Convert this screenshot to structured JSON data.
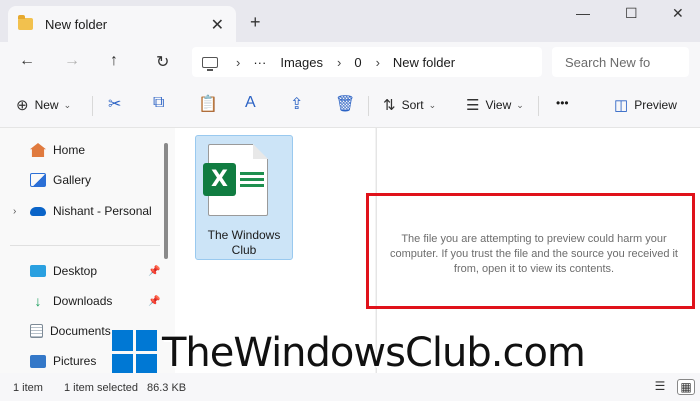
{
  "window": {
    "tab_title": "New folder",
    "tab_close": "✕",
    "new_tab": "+",
    "minimize": "—",
    "maximize": "☐",
    "close": "✕"
  },
  "nav": {
    "back": "←",
    "forward": "→",
    "up": "↑",
    "refresh": "↻"
  },
  "address": {
    "more": "···",
    "separator": "›",
    "crumbs": [
      "Images",
      "0",
      "New folder"
    ]
  },
  "search": {
    "placeholder": "Search New fo"
  },
  "toolbar": {
    "new_label": "New",
    "new_icon": "⊕",
    "chevron": "⌄",
    "cut_icon": "✂",
    "copy_icon": "⧉",
    "paste_icon": "📋",
    "rename_icon": "A",
    "share_icon": "⇪",
    "delete_icon": "🗑",
    "sort_label": "Sort",
    "sort_icon": "⇅",
    "view_label": "View",
    "view_icon": "☰",
    "more_label": "•••",
    "preview_label": "Preview",
    "preview_icon": "◫"
  },
  "sidebar": {
    "expander": "›",
    "pin": "📌",
    "items": [
      {
        "label": "Home",
        "icon": "home-icon",
        "color": "#e07a3e"
      },
      {
        "label": "Gallery",
        "icon": "gallery-icon",
        "color": "#2b6fd6"
      },
      {
        "label": "Nishant - Personal",
        "icon": "onedrive-icon",
        "color": "#0a64c8"
      },
      {
        "label": "Desktop",
        "icon": "desktop-icon",
        "color": "#2aa0e0"
      },
      {
        "label": "Downloads",
        "icon": "downloads-icon",
        "color": "#1a9e5c"
      },
      {
        "label": "Documents",
        "icon": "documents-icon",
        "color": "#7d8a96"
      },
      {
        "label": "Pictures",
        "icon": "pictures-icon",
        "color": "#3478c8"
      }
    ]
  },
  "files": [
    {
      "name_line1": "The Windows",
      "name_line2": "Club",
      "type_icon": "excel-file-icon",
      "badge": "X"
    }
  ],
  "preview": {
    "message": "The file you are attempting to preview could harm your computer. If you trust the file and the source you received it from, open it to view its contents.",
    "highlight_color": "#e0121a"
  },
  "watermark": {
    "text": "TheWindowsClub.com"
  },
  "status": {
    "count": "1 item",
    "selected": "1 item selected",
    "size": "86.3 KB",
    "details_view_icon": "☰",
    "tiles_view_icon": "▦"
  },
  "colors": {
    "accent": "#0078d4",
    "selection": "#cce4f7",
    "excel_green": "#107c41"
  }
}
